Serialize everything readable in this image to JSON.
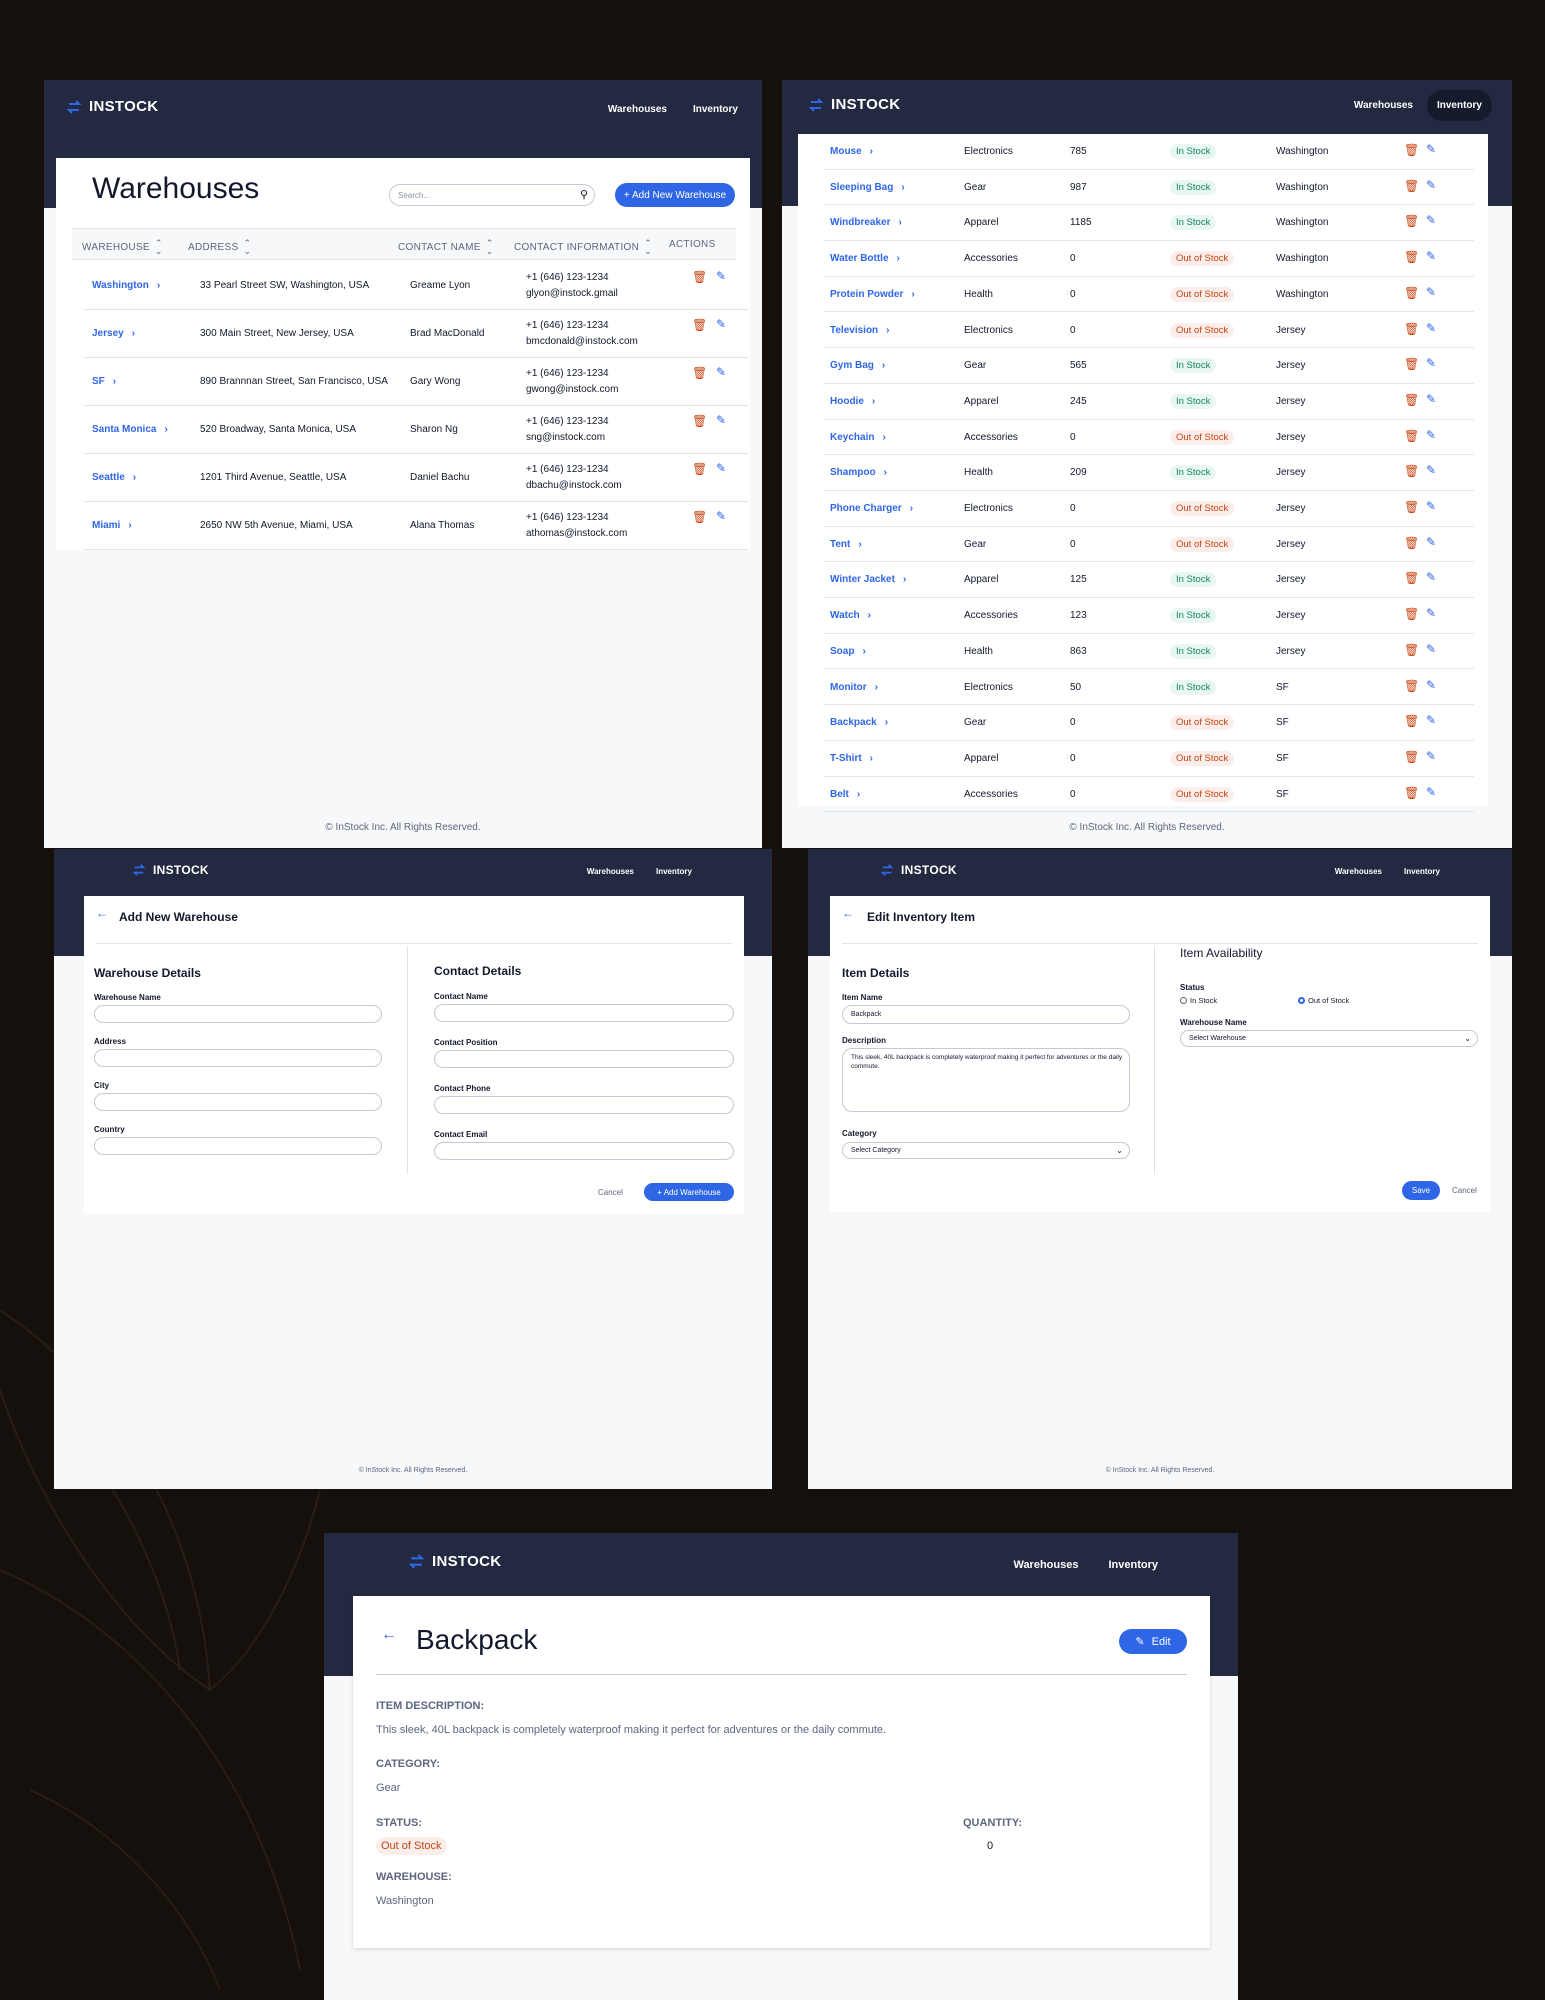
{
  "app": {
    "logo": "INSTOCK",
    "nav_warehouses": "Warehouses",
    "nav_inventory": "Inventory",
    "footer": "© InStock Inc. All Rights Reserved."
  },
  "colors": {
    "header": "#232940",
    "accent": "#2e66e5",
    "danger": "#c94515",
    "success": "#158463",
    "background": "#15100c"
  },
  "icons": {
    "logo": "swap-arrows-icon",
    "search": "search-icon",
    "sort": "sort-icon",
    "chevron": "chevron-right-icon",
    "delete": "trash-icon",
    "edit": "pencil-icon",
    "back": "arrow-left-icon"
  },
  "warehouses": {
    "title": "Warehouses",
    "search_placeholder": "Search...",
    "add_button": "+ Add New Warehouse",
    "columns": [
      "WAREHOUSE",
      "ADDRESS",
      "CONTACT NAME",
      "CONTACT INFORMATION",
      "ACTIONS"
    ],
    "rows": [
      {
        "name": "Washington",
        "address": "33 Pearl Street SW, Washington, USA",
        "contact": "Greame Lyon",
        "phone": "+1 (646) 123-1234",
        "email": "glyon@instock.gmail"
      },
      {
        "name": "Jersey",
        "address": "300 Main Street, New Jersey, USA",
        "contact": "Brad MacDonald",
        "phone": "+1 (646) 123-1234",
        "email": "bmcdonald@instock.com"
      },
      {
        "name": "SF",
        "address": "890 Brannnan Street, San Francisco, USA",
        "contact": "Gary Wong",
        "phone": "+1 (646) 123-1234",
        "email": "gwong@instock.com"
      },
      {
        "name": "Santa Monica",
        "address": "520 Broadway, Santa Monica, USA",
        "contact": "Sharon Ng",
        "phone": "+1 (646) 123-1234",
        "email": "sng@instock.com"
      },
      {
        "name": "Seattle",
        "address": "1201 Third Avenue, Seattle, USA",
        "contact": "Daniel Bachu",
        "phone": "+1 (646) 123-1234",
        "email": "dbachu@instock.com"
      },
      {
        "name": "Miami",
        "address": "2650 NW 5th Avenue, Miami, USA",
        "contact": "Alana Thomas",
        "phone": "+1 (646) 123-1234",
        "email": "athomas@instock.com"
      }
    ]
  },
  "inventory": {
    "rows": [
      {
        "item": "Mouse",
        "category": "Electronics",
        "qty": "785",
        "status": "In Stock",
        "warehouse": "Washington"
      },
      {
        "item": "Sleeping Bag",
        "category": "Gear",
        "qty": "987",
        "status": "In Stock",
        "warehouse": "Washington"
      },
      {
        "item": "Windbreaker",
        "category": "Apparel",
        "qty": "1185",
        "status": "In Stock",
        "warehouse": "Washington"
      },
      {
        "item": "Water Bottle",
        "category": "Accessories",
        "qty": "0",
        "status": "Out of Stock",
        "warehouse": "Washington"
      },
      {
        "item": "Protein Powder",
        "category": "Health",
        "qty": "0",
        "status": "Out of Stock",
        "warehouse": "Washington"
      },
      {
        "item": "Television",
        "category": "Electronics",
        "qty": "0",
        "status": "Out of Stock",
        "warehouse": "Jersey"
      },
      {
        "item": "Gym Bag",
        "category": "Gear",
        "qty": "565",
        "status": "In Stock",
        "warehouse": "Jersey"
      },
      {
        "item": "Hoodie",
        "category": "Apparel",
        "qty": "245",
        "status": "In Stock",
        "warehouse": "Jersey"
      },
      {
        "item": "Keychain",
        "category": "Accessories",
        "qty": "0",
        "status": "Out of Stock",
        "warehouse": "Jersey"
      },
      {
        "item": "Shampoo",
        "category": "Health",
        "qty": "209",
        "status": "In Stock",
        "warehouse": "Jersey"
      },
      {
        "item": "Phone Charger",
        "category": "Electronics",
        "qty": "0",
        "status": "Out of Stock",
        "warehouse": "Jersey"
      },
      {
        "item": "Tent",
        "category": "Gear",
        "qty": "0",
        "status": "Out of Stock",
        "warehouse": "Jersey"
      },
      {
        "item": "Winter Jacket",
        "category": "Apparel",
        "qty": "125",
        "status": "In Stock",
        "warehouse": "Jersey"
      },
      {
        "item": "Watch",
        "category": "Accessories",
        "qty": "123",
        "status": "In Stock",
        "warehouse": "Jersey"
      },
      {
        "item": "Soap",
        "category": "Health",
        "qty": "863",
        "status": "In Stock",
        "warehouse": "Jersey"
      },
      {
        "item": "Monitor",
        "category": "Electronics",
        "qty": "50",
        "status": "In Stock",
        "warehouse": "SF"
      },
      {
        "item": "Backpack",
        "category": "Gear",
        "qty": "0",
        "status": "Out of Stock",
        "warehouse": "SF"
      },
      {
        "item": "T-Shirt",
        "category": "Apparel",
        "qty": "0",
        "status": "Out of Stock",
        "warehouse": "SF"
      },
      {
        "item": "Belt",
        "category": "Accessories",
        "qty": "0",
        "status": "Out of Stock",
        "warehouse": "SF"
      }
    ]
  },
  "add_warehouse": {
    "title": "Add New Warehouse",
    "details_heading": "Warehouse Details",
    "contact_heading": "Contact Details",
    "warehouse_fields": [
      "Warehouse Name",
      "Address",
      "City",
      "Country"
    ],
    "contact_fields": [
      "Contact Name",
      "Contact Position",
      "Contact Phone",
      "Contact Email"
    ],
    "cancel": "Cancel",
    "submit": "+ Add Warehouse"
  },
  "edit_item": {
    "title": "Edit Inventory Item",
    "details_heading": "Item Details",
    "availability_heading": "Item Availability",
    "item_name_label": "Item Name",
    "item_name_value": "Backpack",
    "description_label": "Description",
    "description_value": "This sleek, 40L backpack is completely waterproof making it perfect for adventures or the daily commute.",
    "category_label": "Category",
    "category_value": "Select Category",
    "status_label": "Status",
    "status_in": "In Stock",
    "status_out": "Out of Stock",
    "warehouse_label": "Warehouse Name",
    "warehouse_value": "Select Warehouse",
    "save": "Save",
    "cancel": "Cancel"
  },
  "item_detail": {
    "title": "Backpack",
    "edit": "Edit",
    "desc_label": "ITEM DESCRIPTION:",
    "desc_value": "This sleek, 40L backpack is completely waterproof making it perfect for adventures or the daily commute.",
    "category_label": "CATEGORY:",
    "category_value": "Gear",
    "status_label": "STATUS:",
    "status_value": "Out of Stock",
    "quantity_label": "QUANTITY:",
    "quantity_value": "0",
    "warehouse_label": "WAREHOUSE:",
    "warehouse_value": "Washington"
  }
}
